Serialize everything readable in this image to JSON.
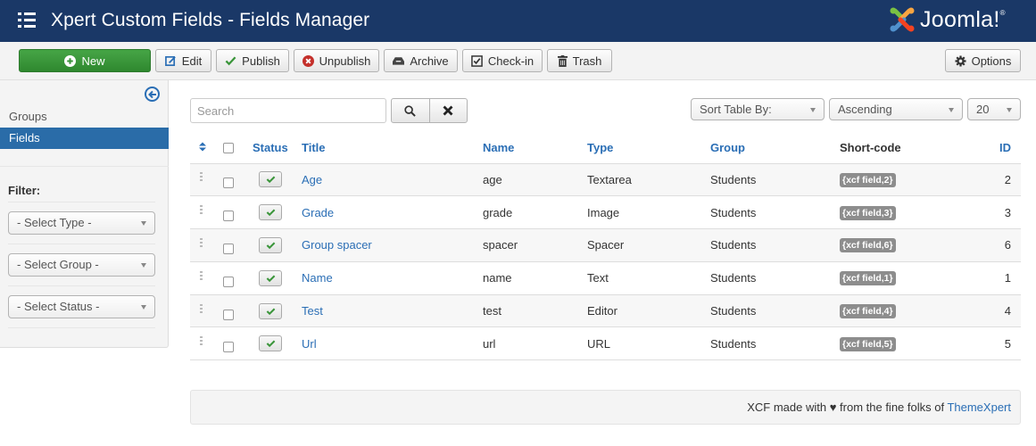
{
  "header": {
    "title": "Xpert Custom Fields - Fields Manager",
    "logo_text": "Joomla!",
    "logo_mark": "®"
  },
  "toolbar": {
    "buttons": [
      {
        "label": "New",
        "icon": "plus-circle-icon"
      },
      {
        "label": "Edit",
        "icon": "edit-icon"
      },
      {
        "label": "Publish",
        "icon": "check-icon"
      },
      {
        "label": "Unpublish",
        "icon": "x-circle-icon"
      },
      {
        "label": "Archive",
        "icon": "archive-icon"
      },
      {
        "label": "Check-in",
        "icon": "checkbox-icon"
      },
      {
        "label": "Trash",
        "icon": "trash-icon"
      }
    ],
    "options_label": "Options"
  },
  "sidebar": {
    "items": [
      {
        "label": "Groups",
        "active": false
      },
      {
        "label": "Fields",
        "active": true
      }
    ],
    "filter_label": "Filter:",
    "filters": [
      {
        "value": "- Select Type -"
      },
      {
        "value": "- Select Group -"
      },
      {
        "value": "- Select Status -"
      }
    ]
  },
  "search": {
    "placeholder": "Search",
    "value": ""
  },
  "sorting": {
    "sort_by": "Sort Table By:",
    "direction": "Ascending",
    "limit": "20"
  },
  "table": {
    "columns": [
      "Status",
      "Title",
      "Name",
      "Type",
      "Group",
      "Short-code",
      "ID"
    ],
    "rows": [
      {
        "title": "Age",
        "name": "age",
        "type": "Textarea",
        "group": "Students",
        "shortcode": "{xcf field,2}",
        "id": "2",
        "published": true
      },
      {
        "title": "Grade",
        "name": "grade",
        "type": "Image",
        "group": "Students",
        "shortcode": "{xcf field,3}",
        "id": "3",
        "published": true
      },
      {
        "title": "Group spacer",
        "name": "spacer",
        "type": "Spacer",
        "group": "Students",
        "shortcode": "{xcf field,6}",
        "id": "6",
        "published": true
      },
      {
        "title": "Name",
        "name": "name",
        "type": "Text",
        "group": "Students",
        "shortcode": "{xcf field,1}",
        "id": "1",
        "published": true
      },
      {
        "title": "Test",
        "name": "test",
        "type": "Editor",
        "group": "Students",
        "shortcode": "{xcf field,4}",
        "id": "4",
        "published": true
      },
      {
        "title": "Url",
        "name": "url",
        "type": "URL",
        "group": "Students",
        "shortcode": "{xcf field,5}",
        "id": "5",
        "published": true
      }
    ]
  },
  "footer": {
    "text_before": "XCF made with ♥ from the fine folks of ",
    "link_label": "ThemeXpert"
  },
  "colors": {
    "header_bg": "#1a3867",
    "accent": "#2a6eb5",
    "new_button": "#3d9a3d",
    "badge": "#8d8d8d"
  }
}
